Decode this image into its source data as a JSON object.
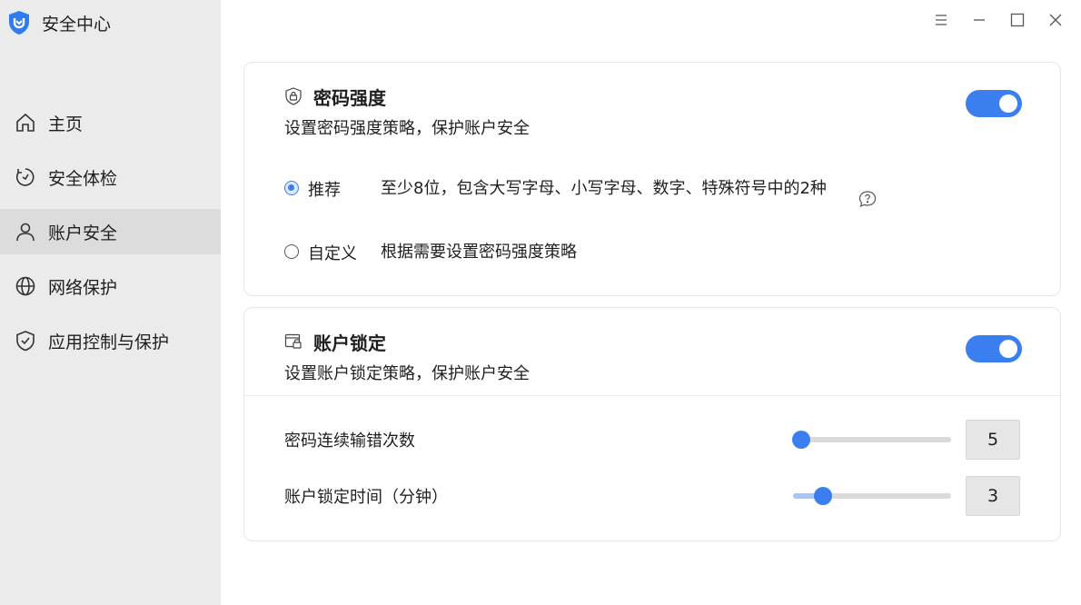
{
  "app": {
    "title": "安全中心"
  },
  "sidebar": {
    "items": [
      {
        "label": "主页",
        "icon": "home-icon",
        "active": false
      },
      {
        "label": "安全体检",
        "icon": "refresh-check-icon",
        "active": false
      },
      {
        "label": "账户安全",
        "icon": "user-icon",
        "active": true
      },
      {
        "label": "网络保护",
        "icon": "globe-icon",
        "active": false
      },
      {
        "label": "应用控制与保护",
        "icon": "shield-check-icon",
        "active": false
      }
    ]
  },
  "window_controls": [
    "menu-icon",
    "minimize-icon",
    "maximize-icon",
    "close-icon"
  ],
  "password_strength": {
    "title": "密码强度",
    "description": "设置密码强度策略，保护账户安全",
    "enabled": true,
    "options": [
      {
        "label": "推荐",
        "description": "至少8位，包含大写字母、小写字母、数字、特殊符号中的2种",
        "checked": true
      },
      {
        "label": "自定义",
        "description": "根据需要设置密码强度策略",
        "checked": false
      }
    ]
  },
  "account_lock": {
    "title": "账户锁定",
    "description": "设置账户锁定策略，保护账户安全",
    "enabled": true,
    "settings": [
      {
        "label": "密码连续输错次数",
        "value": "5",
        "fraction": 0.05
      },
      {
        "label": "账户锁定时间（分钟）",
        "value": "3",
        "fraction": 0.19
      }
    ]
  },
  "colors": {
    "accent": "#3a7ef0",
    "sidebar_bg": "#ebebeb",
    "active_item_bg": "#dcdcdc"
  }
}
